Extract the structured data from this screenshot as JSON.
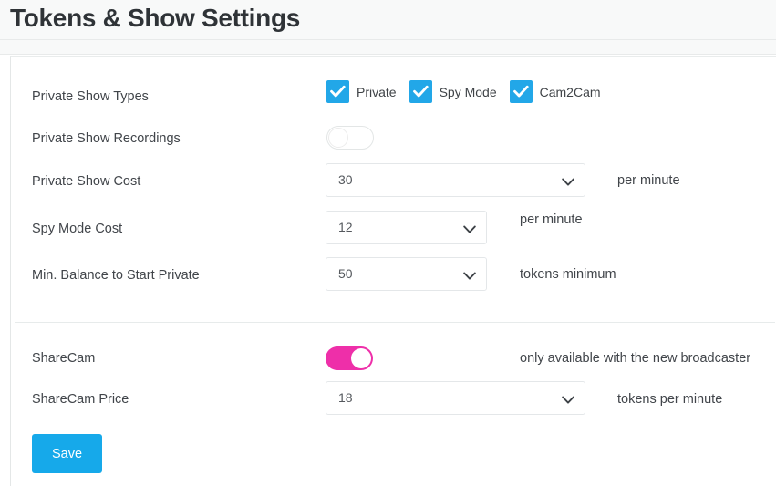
{
  "header": {
    "title": "Tokens & Show Settings"
  },
  "theme": {
    "checkbox_blue": "#22a7e8",
    "toggle_on_pink": "#ee2fa9",
    "save_blue": "#16a9ea",
    "header_bg": "#f8f9f9",
    "border_grey": "#e4e7e9",
    "text_color": "#41454a"
  },
  "form": {
    "private_show_types": {
      "label": "Private Show Types",
      "options": [
        {
          "label": "Private",
          "checked": true
        },
        {
          "label": "Spy Mode",
          "checked": true
        },
        {
          "label": "Cam2Cam",
          "checked": true
        }
      ]
    },
    "private_show_recordings": {
      "label": "Private Show Recordings",
      "state": "off"
    },
    "private_show_cost": {
      "label": "Private Show Cost",
      "value": "30",
      "suffix": "per minute"
    },
    "spy_mode_cost": {
      "label": "Spy Mode Cost",
      "value": "12",
      "suffix": "per minute"
    },
    "min_balance": {
      "label": "Min. Balance to Start Private",
      "value": "50",
      "suffix": "tokens minimum"
    },
    "sharecam": {
      "label": "ShareCam",
      "state": "on",
      "note": "only available with the new broadcaster"
    },
    "sharecam_price": {
      "label": "ShareCam Price",
      "value": "18",
      "suffix": "tokens per minute"
    }
  },
  "actions": {
    "save_label": "Save"
  }
}
